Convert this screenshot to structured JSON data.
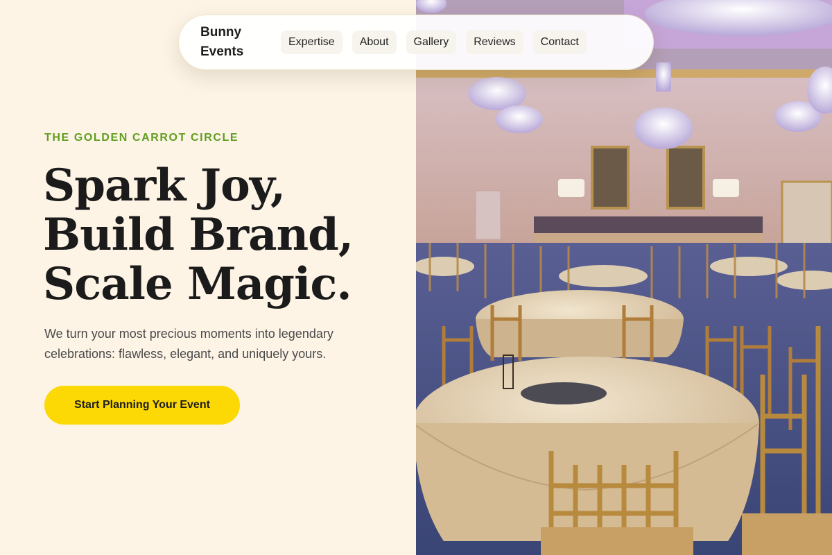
{
  "nav": {
    "brand": "Bunny\nEvents",
    "links": [
      "Expertise",
      "About",
      "Gallery",
      "Reviews",
      "Contact"
    ]
  },
  "hero": {
    "eyebrow": "THE GOLDEN CARROT CIRCLE",
    "headline": [
      "Spark Joy,",
      "Build Brand,",
      "Scale Magic."
    ],
    "subtext": "We turn your most precious moments into legendary celebrations: flawless, elegant, and uniquely yours.",
    "cta_label": "Start Planning Your Event"
  },
  "colors": {
    "background": "#fdf4e6",
    "eyebrow": "#5f9e1f",
    "cta": "#fcd805",
    "text": "#1d1d1b"
  },
  "image": {
    "alt": "Banquet hall with round tables, gold chiavari chairs and crystal chandeliers"
  }
}
